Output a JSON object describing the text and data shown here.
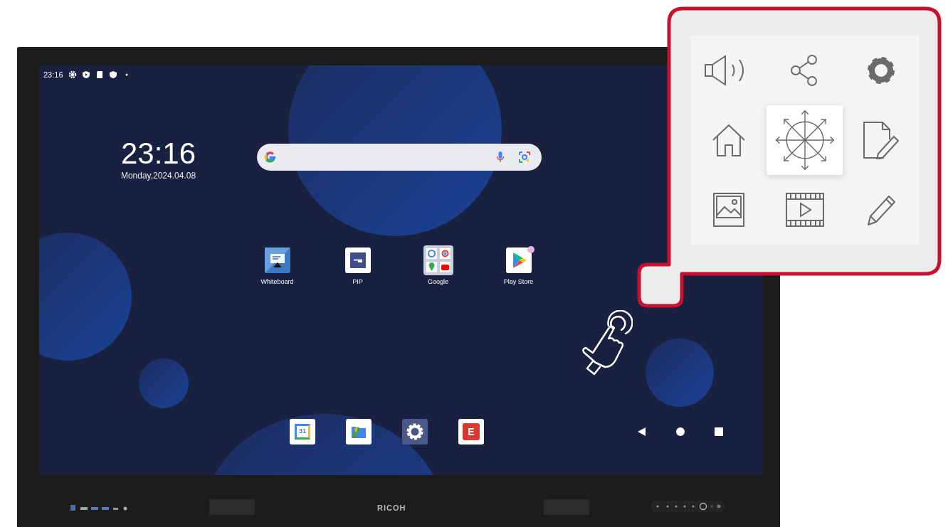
{
  "status_bar": {
    "time": "23:16"
  },
  "clock_widget": {
    "time": "23:16",
    "date": "Monday,2024.04.08"
  },
  "search_bar": {
    "kind": "google"
  },
  "apps": [
    {
      "kind": "whiteboard",
      "label": "Whiteboard",
      "notification_dot": false
    },
    {
      "kind": "pip",
      "label": "PIP",
      "notification_dot": false
    },
    {
      "kind": "folder",
      "label": "Google",
      "notification_dot": false
    },
    {
      "kind": "playstore",
      "label": "Play Store",
      "notification_dot": true
    }
  ],
  "dock": [
    {
      "kind": "calendar",
      "label": "31"
    },
    {
      "kind": "files"
    },
    {
      "kind": "settings"
    },
    {
      "kind": "eshare",
      "label": "E"
    }
  ],
  "nav_buttons": [
    {
      "kind": "back"
    },
    {
      "kind": "home"
    },
    {
      "kind": "recents"
    }
  ],
  "bezel": {
    "brand": "RICOH"
  },
  "quick_menu": {
    "tiles": [
      {
        "kind": "volume",
        "selected": false
      },
      {
        "kind": "share",
        "selected": false
      },
      {
        "kind": "settings",
        "selected": false
      },
      {
        "kind": "home",
        "selected": false
      },
      {
        "kind": "move",
        "selected": true
      },
      {
        "kind": "note",
        "selected": false
      },
      {
        "kind": "image",
        "selected": false
      },
      {
        "kind": "video",
        "selected": false
      },
      {
        "kind": "pencil",
        "selected": false
      }
    ]
  }
}
